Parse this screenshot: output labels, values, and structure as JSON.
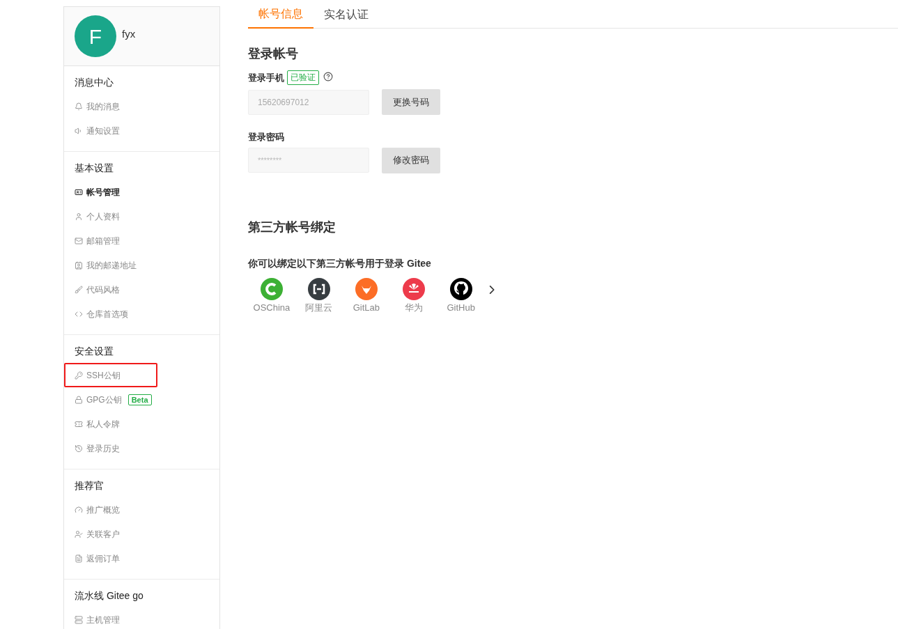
{
  "user": {
    "avatar_letter": "F",
    "name": "fyx"
  },
  "sidebar": {
    "sections": [
      {
        "title": "消息中心",
        "items": [
          {
            "label": "我的消息",
            "selected": false,
            "highlighted": false
          },
          {
            "label": "通知设置",
            "selected": false,
            "highlighted": false
          }
        ]
      },
      {
        "title": "基本设置",
        "items": [
          {
            "label": "帐号管理",
            "selected": true,
            "highlighted": false
          },
          {
            "label": "个人资料",
            "selected": false,
            "highlighted": false
          },
          {
            "label": "邮箱管理",
            "selected": false,
            "highlighted": false
          },
          {
            "label": "我的邮递地址",
            "selected": false,
            "highlighted": false
          },
          {
            "label": "代码风格",
            "selected": false,
            "highlighted": false
          },
          {
            "label": "仓库首选项",
            "selected": false,
            "highlighted": false
          }
        ]
      },
      {
        "title": "安全设置",
        "items": [
          {
            "label": "SSH公钥",
            "selected": false,
            "highlighted": true
          },
          {
            "label": "GPG公钥",
            "badge": "Beta",
            "selected": false,
            "highlighted": false
          },
          {
            "label": "私人令牌",
            "selected": false,
            "highlighted": false
          },
          {
            "label": "登录历史",
            "selected": false,
            "highlighted": false
          }
        ]
      },
      {
        "title": "推荐官",
        "items": [
          {
            "label": "推广概览",
            "selected": false,
            "highlighted": false
          },
          {
            "label": "关联客户",
            "selected": false,
            "highlighted": false
          },
          {
            "label": "返佣订单",
            "selected": false,
            "highlighted": false
          }
        ]
      },
      {
        "title": "流水线 Gitee go",
        "items": [
          {
            "label": "主机管理",
            "selected": false,
            "highlighted": false
          }
        ]
      }
    ]
  },
  "tabs": [
    {
      "label": "帐号信息",
      "selected": true
    },
    {
      "label": "实名认证",
      "selected": false
    }
  ],
  "login": {
    "heading": "登录帐号",
    "phone": {
      "label": "登录手机",
      "badge": "已验证",
      "value": "15620697012",
      "button": "更换号码"
    },
    "password": {
      "label": "登录密码",
      "value": "********",
      "button": "修改密码"
    }
  },
  "third_party": {
    "heading": "第三方帐号绑定",
    "intro": "你可以绑定以下第三方帐号用于登录 Gitee",
    "providers": [
      {
        "name": "OSChina",
        "color": "#3cb034"
      },
      {
        "name": "阿里云",
        "color": "#373d41"
      },
      {
        "name": "GitLab",
        "color": "#fc6d26"
      },
      {
        "name": "华为",
        "color": "#ed3b4b"
      },
      {
        "name": "GitHub",
        "color": "#000000"
      }
    ]
  }
}
